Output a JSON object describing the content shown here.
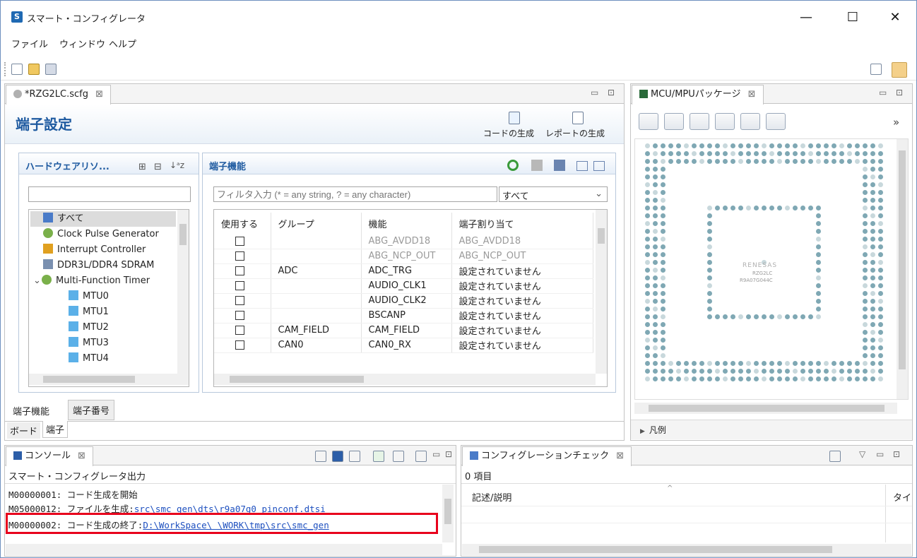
{
  "window": {
    "title": "スマート・コンフィグレータ",
    "controls": {
      "minimize": "—",
      "maximize": "☐",
      "close": "✕"
    }
  },
  "menu": [
    "ファイル",
    "ウィンドウ",
    "ヘルプ"
  ],
  "editor": {
    "tab_label": "*RZG2LC.scfg",
    "tab_close": "⊠",
    "heading": "端子設定",
    "generate_code_label": "コードの生成",
    "generate_report_label": "レポートの生成",
    "hardware_section": {
      "title": "ハードウェアリソ...",
      "search_value": "",
      "tree": [
        {
          "label": "すべて",
          "icon": "all-icon"
        },
        {
          "label": "Clock Pulse Generator",
          "icon": "clock-icon"
        },
        {
          "label": "Interrupt Controller",
          "icon": "chip-icon"
        },
        {
          "label": "DDR3L/DDR4 SDRAM",
          "icon": "memory-icon"
        },
        {
          "label": "Multi-Function Timer",
          "icon": "clock-icon"
        },
        {
          "label": "MTU0",
          "icon": "cube-icon"
        },
        {
          "label": "MTU1",
          "icon": "cube-icon"
        },
        {
          "label": "MTU2",
          "icon": "cube-icon"
        },
        {
          "label": "MTU3",
          "icon": "cube-icon"
        },
        {
          "label": "MTU4",
          "icon": "cube-icon"
        }
      ]
    },
    "pin_function_section": {
      "title": "端子機能",
      "filter_placeholder": "フィルタ入力 (* = any string, ? = any character)",
      "filter_select": "すべて",
      "columns": [
        "使用する",
        "グループ",
        "機能",
        "端子割り当て"
      ],
      "rows": [
        {
          "group": "",
          "function": "ABG_AVDD18",
          "assign": "ABG_AVDD18",
          "gray": true
        },
        {
          "group": "",
          "function": "ABG_NCP_OUT",
          "assign": "ABG_NCP_OUT",
          "gray": true
        },
        {
          "group": "ADC",
          "function": "ADC_TRG",
          "assign": "設定されていません",
          "gray": false
        },
        {
          "group": "",
          "function": "AUDIO_CLK1",
          "assign": "設定されていません",
          "gray": false
        },
        {
          "group": "",
          "function": "AUDIO_CLK2",
          "assign": "設定されていません",
          "gray": false
        },
        {
          "group": "",
          "function": "BSCANP",
          "assign": "設定されていません",
          "gray": false
        },
        {
          "group": "CAM_FIELD",
          "function": "CAM_FIELD",
          "assign": "設定されていません",
          "gray": false
        },
        {
          "group": "CAN0",
          "function": "CAN0_RX",
          "assign": "設定されていません",
          "gray": false
        }
      ]
    },
    "bottom_tabs": [
      "端子機能",
      "端子番号"
    ],
    "view_tabs": [
      "ボード",
      "端子"
    ]
  },
  "package_view": {
    "tab_label": "MCU/MPUパッケージ",
    "tab_close": "⊠",
    "more": "»",
    "chip_text_1": "RENESAS",
    "chip_text_2": "RZG2LC",
    "chip_text_3": "R9A07G044C",
    "legend": "凡例"
  },
  "console": {
    "tab_label": "コンソール",
    "tab_close": "⊠",
    "header": "スマート・コンフィグレータ出力",
    "lines": [
      {
        "code": "M00000001:",
        "text": " コード生成を開始",
        "link": ""
      },
      {
        "code": "M05000012:",
        "text": " ファイルを生成:",
        "link": "src\\smc_gen\\dts\\r9a07g0_pinconf.dtsi"
      },
      {
        "code": "M00000002:",
        "text": " コード生成の終了:",
        "link": "D:\\WorkSpace\\      \\WORK\\tmp\\src\\smc_gen"
      }
    ]
  },
  "config_check": {
    "tab_label": "コンフィグレーションチェック",
    "tab_close": "⊠",
    "count": "0 項目",
    "col_desc": "記述/説明",
    "col_type": "タイプ"
  }
}
